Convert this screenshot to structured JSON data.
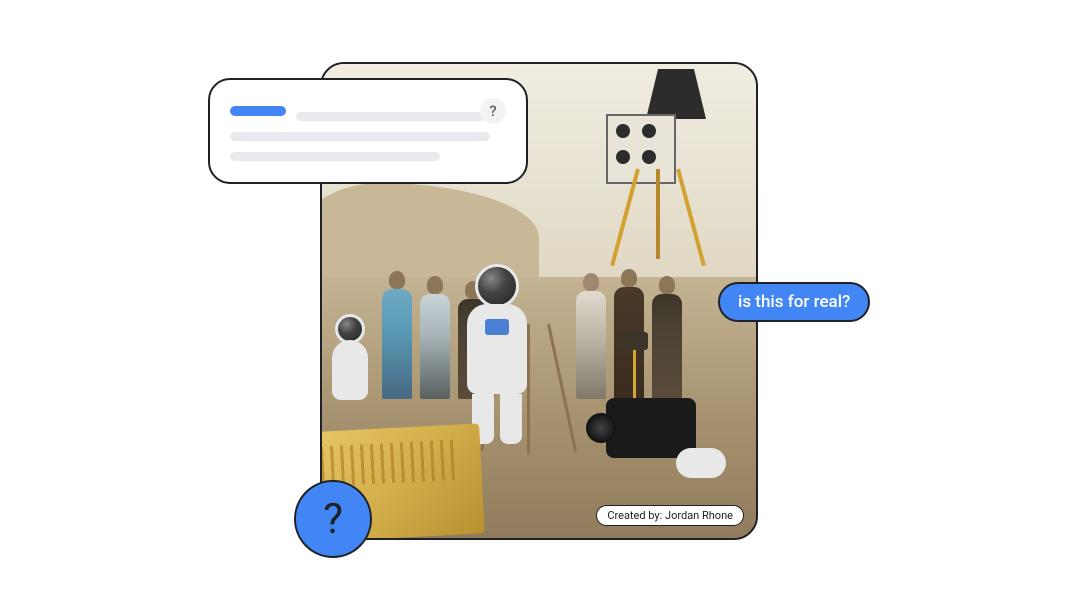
{
  "speech_bubble": {
    "text": "is this for real?"
  },
  "question_badge": {
    "glyph": "?"
  },
  "result_card": {
    "help_glyph": "?"
  },
  "credit": {
    "prefix": "Created by: ",
    "author": "Jordan Rhone"
  },
  "image": {
    "alt": "Film set in a desert staged to look like a moon landing: an astronaut in a white suit stands at a tripod, surrounded by a film crew and camera equipment, with a lunar-lander prop in the background."
  }
}
